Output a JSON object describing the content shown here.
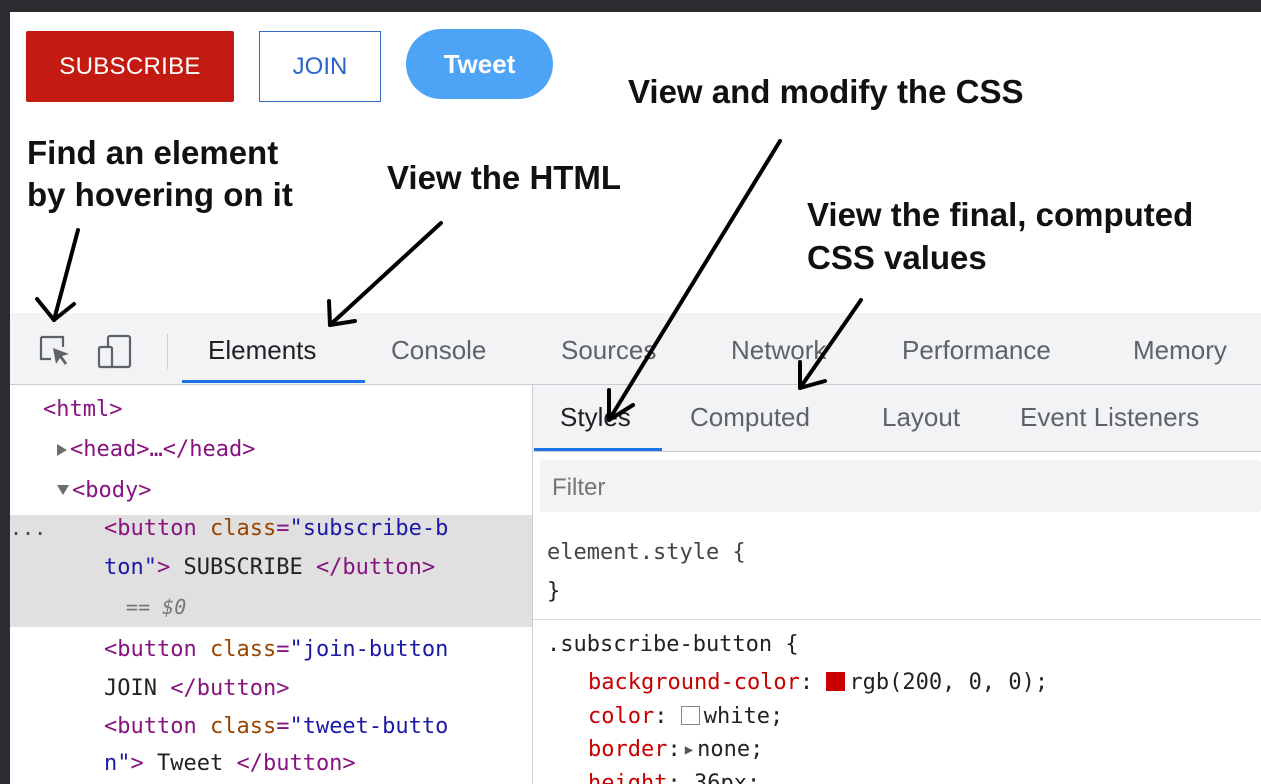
{
  "demo_buttons": {
    "subscribe": "SUBSCRIBE",
    "join": "JOIN",
    "tweet": "Tweet"
  },
  "annotations": {
    "view_css": "View and modify the CSS",
    "find_line1": "Find an element",
    "find_line2": "by hovering on it",
    "view_html": "View the HTML",
    "computed_line1": "View the final, computed",
    "computed_line2": "CSS values"
  },
  "toolbar": {
    "icons": [
      "inspect-element-icon",
      "device-toggle-icon"
    ],
    "tabs": [
      "Elements",
      "Console",
      "Sources",
      "Network",
      "Performance",
      "Memory"
    ],
    "active_tab": "Elements"
  },
  "elements_tree": {
    "html_open": "<html>",
    "head": "<head>…</head>",
    "body_open": "<body>",
    "ellipsis": "...",
    "btn1_open": "<button ",
    "btn1_attr": "class",
    "btn1_val_a": "\"subscribe-b",
    "btn1_val_b": "ton\"",
    "btn1_close_a": ">",
    "btn1_text": " SUBSCRIBE ",
    "btn1_close_b": "</button>",
    "eq": " == ",
    "dollar0": "$0",
    "btn2_open": "<button ",
    "btn2_attr": "class",
    "btn2_val": "\"join-button",
    "btn2_text": "JOIN ",
    "btn2_close": "</button>",
    "btn3_open": "<button ",
    "btn3_attr": "class",
    "btn3_val_a": "\"tweet-butto",
    "btn3_val_b": "n\"",
    "btn3_close_a": ">",
    "btn3_text": " Tweet ",
    "btn3_close_b": "</button>"
  },
  "styles_panel": {
    "tabs": [
      "Styles",
      "Computed",
      "Layout",
      "Event Listeners"
    ],
    "active_tab": "Styles",
    "filter_placeholder": "Filter",
    "element_style": "element.style {",
    "element_style_close": "}",
    "rule_selector": ".subscribe-button {",
    "declarations": [
      {
        "prop": "background-color",
        "value": "rgb(200, 0, 0);",
        "swatch": "#c80000"
      },
      {
        "prop": "color",
        "value": "white;",
        "swatch": "#ffffff"
      },
      {
        "prop": "border",
        "value": "none;",
        "expander": true
      },
      {
        "prop": "height",
        "value": "36px;"
      }
    ]
  },
  "colors": {
    "subscribe_bg": "#c31a12",
    "join_border": "#3669c9",
    "tweet_bg": "#4da3f5",
    "active_tab_underline": "#1a73e8",
    "tag_color": "#881280",
    "attr_color": "#994500",
    "value_color": "#1a1aa6",
    "css_prop_color": "#c80000"
  }
}
